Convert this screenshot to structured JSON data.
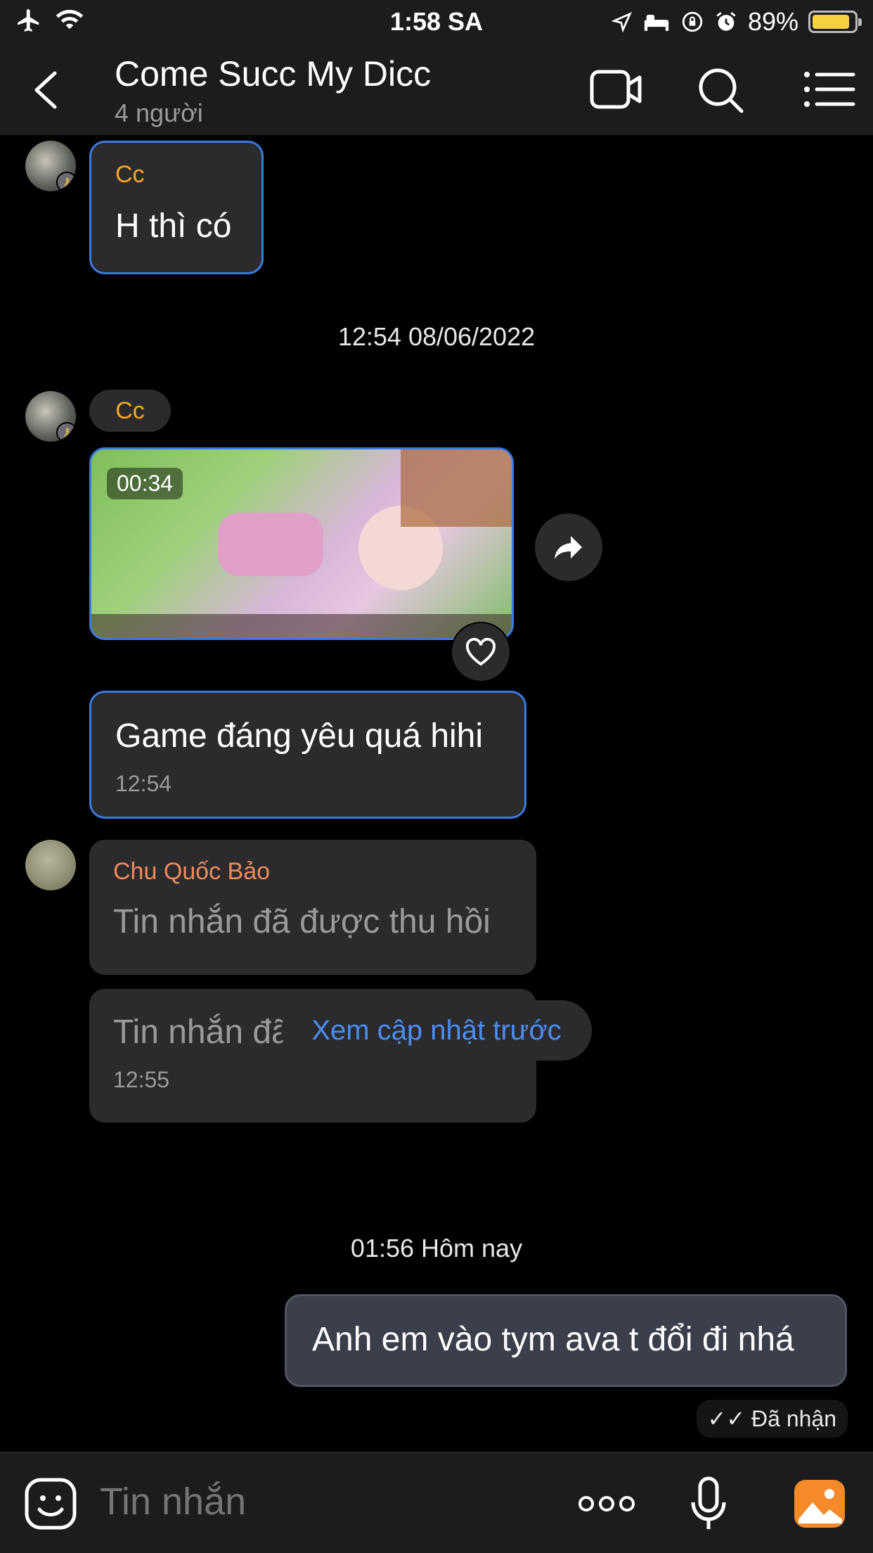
{
  "status_bar": {
    "time": "1:58 SA",
    "battery": "89%",
    "battery_level": 0.89
  },
  "header": {
    "title": "Come Succ My Dicc",
    "subtitle": "4 người"
  },
  "messages": {
    "m1": {
      "sender": "Cc",
      "text": "H thì có"
    },
    "date1": "12:54 08/06/2022",
    "m2": {
      "sender": "Cc",
      "video_duration": "00:34"
    },
    "m3": {
      "text": "Game đáng yêu quá hihi",
      "time": "12:54"
    },
    "m4": {
      "sender": "Chu Quốc Bảo",
      "text": "Tin nhắn đã được thu hồi"
    },
    "m5": {
      "text": "Tin nhắn đã được thu hồi",
      "time": "12:55"
    },
    "load_previous": "Xem cập nhật trước",
    "date2": "01:56 Hôm nay",
    "own": {
      "text": "Anh em vào tym ava t đổi đi nhá",
      "status": "Đã nhận"
    }
  },
  "input": {
    "placeholder": "Tin nhắn"
  },
  "colors": {
    "accent_blue": "#3b7ae0",
    "sender_yellow": "#f5a623",
    "sender_orange": "#f08a5d",
    "bubble": "#2b2b2e",
    "own_bubble": "#3a3f4b"
  }
}
